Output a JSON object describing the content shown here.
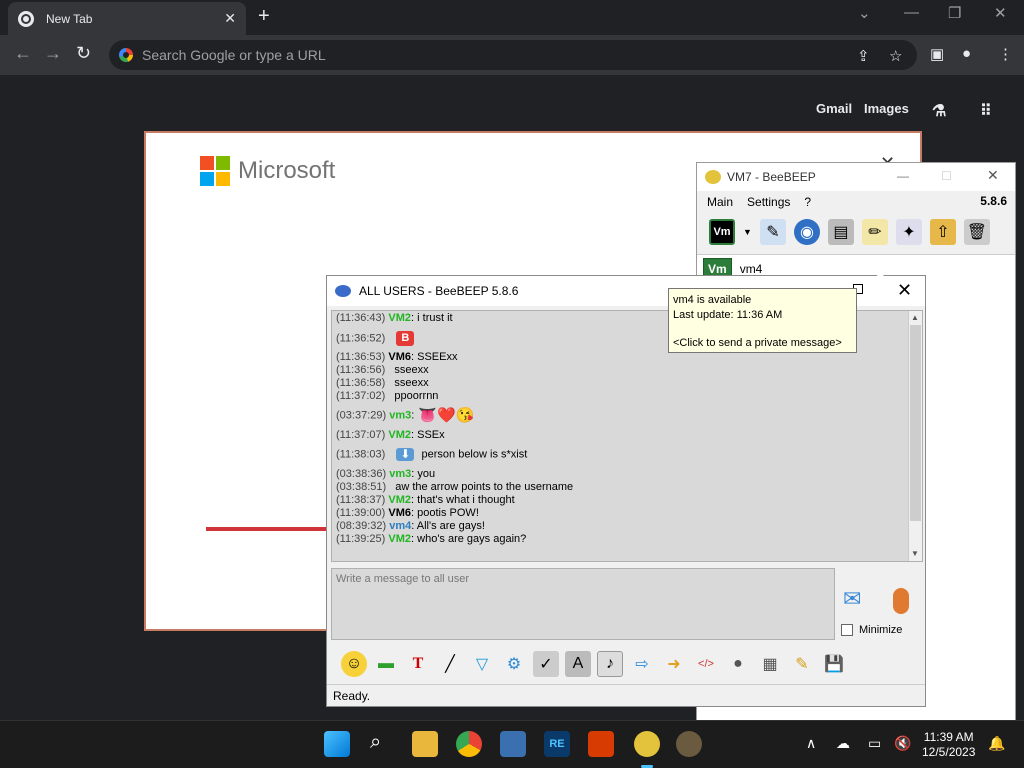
{
  "browser": {
    "tab_title": "New Tab",
    "tab_close": "✕",
    "new_tab": "+",
    "search_placeholder": "Search Google or type a URL",
    "ntp_links": [
      "Gmail",
      "Images"
    ]
  },
  "microsoft_panel": {
    "brand": "Microsoft",
    "close": "✕",
    "colors": [
      "#f25022",
      "#7fba00",
      "#00a4ef",
      "#ffb900"
    ]
  },
  "vm7_window": {
    "title": "VM7 - BeeBEEP",
    "menu": [
      "Main",
      "Settings",
      "?"
    ],
    "version": "5.8.6",
    "user_badge": "Vm",
    "users": [
      {
        "badge": "Vm",
        "name": "vm4"
      }
    ]
  },
  "tooltip": {
    "line1": "vm4 is available",
    "line2": "Last update: 11:36 AM",
    "line3": "<Click to send a private message>"
  },
  "chat_window": {
    "title": "ALL USERS - BeeBEEP 5.8.6",
    "messages": [
      {
        "time": "(11:36:43)",
        "user": "VM2",
        "user_color": "green",
        "text": " i trust it"
      },
      {
        "time": "",
        "user": "",
        "user_color": "",
        "text": ""
      },
      {
        "time": "(11:36:52)",
        "user": "",
        "user_color": "",
        "text": "",
        "emoji": "B"
      },
      {
        "time": "(11:36:53)",
        "user": "VM6",
        "user_color": "black",
        "text": " SSEExx"
      },
      {
        "time": "(11:36:56)",
        "user": "",
        "user_color": "",
        "text": "sseexx"
      },
      {
        "time": "(11:36:58)",
        "user": "",
        "user_color": "",
        "text": "sseexx"
      },
      {
        "time": "(11:37:02)",
        "user": "",
        "user_color": "",
        "text": "ppoorrnn"
      },
      {
        "time": "",
        "user": "",
        "user_color": "",
        "text": ""
      },
      {
        "time": "(03:37:29)",
        "user": "vm3",
        "user_color": "green",
        "text": "",
        "emoji": "👅❤️😘"
      },
      {
        "time": "(11:37:07)",
        "user": "VM2",
        "user_color": "green",
        "text": " SSEx"
      },
      {
        "time": "",
        "user": "",
        "user_color": "",
        "text": ""
      },
      {
        "time": "(11:38:03)",
        "user": "",
        "user_color": "",
        "text": "person below is s*xist",
        "emoji": "⬇"
      },
      {
        "time": "(03:38:36)",
        "user": "vm3",
        "user_color": "green",
        "text": " you"
      },
      {
        "time": "(03:38:51)",
        "user": "",
        "user_color": "",
        "text": "aw the arrow points to the username"
      },
      {
        "time": "(11:38:37)",
        "user": "VM2",
        "user_color": "green",
        "text": " that's what i thought"
      },
      {
        "time": "(11:39:00)",
        "user": "VM6",
        "user_color": "black",
        "text": " pootis POW!"
      },
      {
        "time": "(08:39:32)",
        "user": "vm4",
        "user_color": "blue",
        "text": " All's are gays!"
      },
      {
        "time": "(11:39:25)",
        "user": "VM2",
        "user_color": "green",
        "text": " who's are gays again?"
      }
    ],
    "input_placeholder": "Write a message to all user",
    "minimize_label": "Minimize",
    "status": "Ready."
  },
  "taskbar": {
    "time": "11:39 AM",
    "date": "12/5/2023"
  }
}
